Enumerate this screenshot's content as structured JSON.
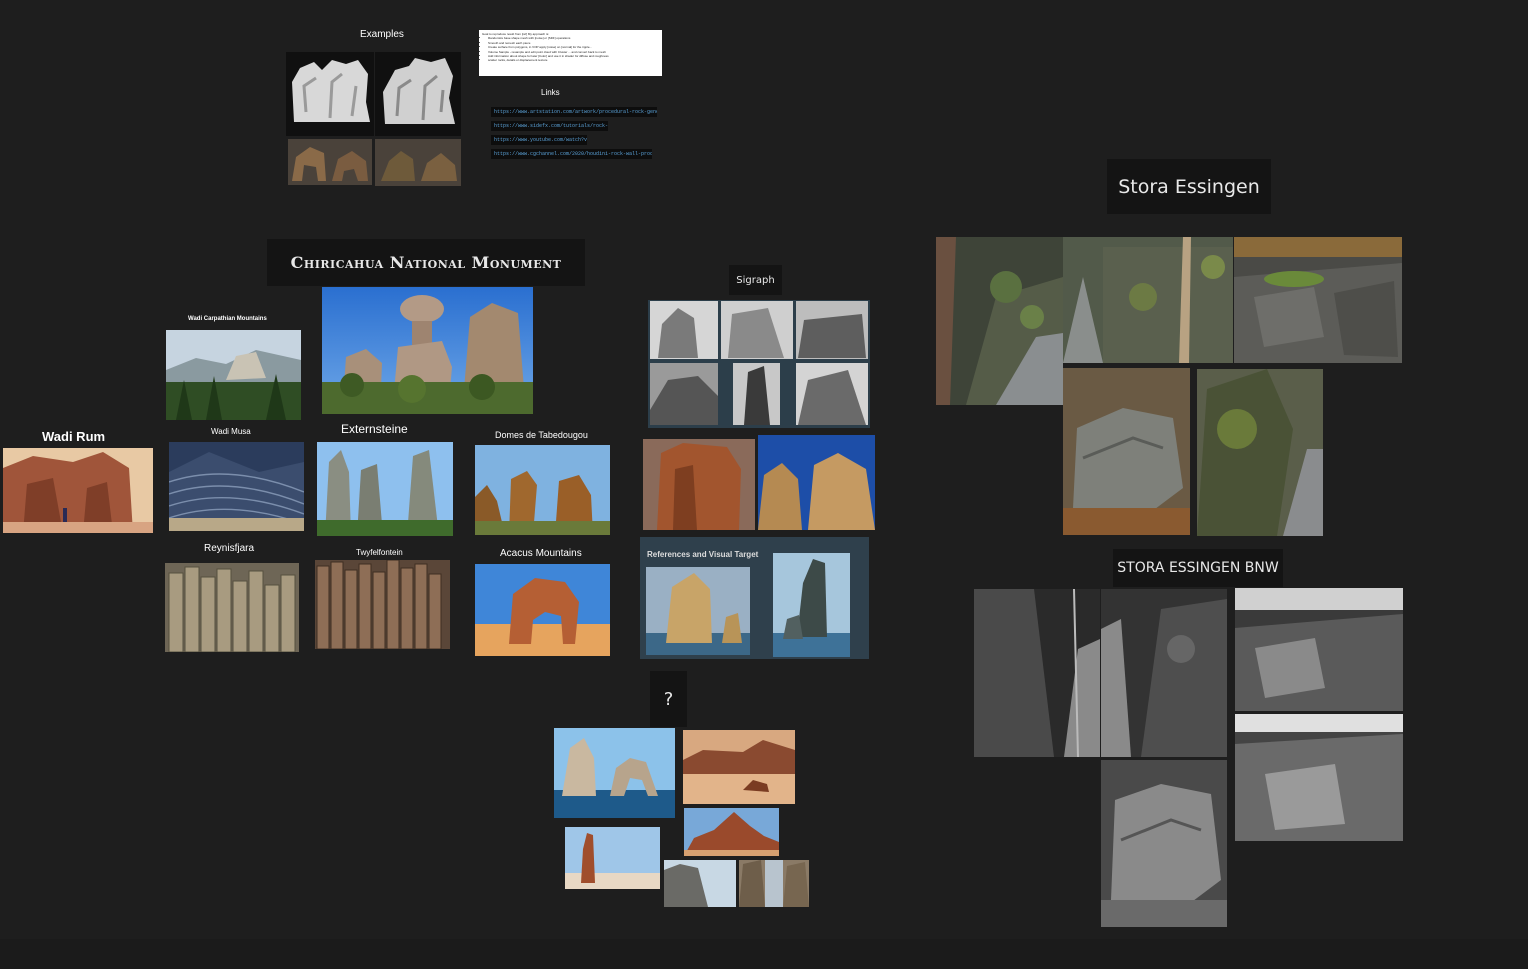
{
  "board": {
    "examples_title": "Examples",
    "links_title": "Links",
    "note_lines": [
      "Goal to reproduce result from [ref] My approach is:",
      "Randomize base shape mesh with [noise] or [SDF] operations",
      "Smooth and remesh each piece",
      "Create surface from polygons, in VOP apply [noise] on [normal] for the ripple...",
      "Volume Sample - resample and edit point cloud with Cluster ... and convert back to mesh",
      "Add information about shape for later [Color] and use it in shader for diffuse and roughness",
      "scatter rocks, details or displacement texture"
    ],
    "links": [
      "https://www.artstation.com/artwork/procedural-rock-generator-houdini",
      "https://www.sidefx.com/tutorials/rock-generator/",
      "https://www.youtube.com/watch?v=rock_tut",
      "https://www.cgchannel.com/2020/houdini-rock-wall-procedural"
    ],
    "headings": {
      "chiricahua": "Chiricahua National Monument",
      "sigraph": "Sigraph",
      "question": "?",
      "stora": "Stora Essingen",
      "stora_bnw": "STORA ESSINGEN BNW"
    },
    "captions": {
      "carpathian": "Wadi Carpathian Mountains",
      "wadi_rum": "Wadi Rum",
      "wadi_musa": "Wadi Musa",
      "externsteine": "Externsteine",
      "domes": "Domes de Tabedougou",
      "reynisfjara": "Reynisfjara",
      "twyfelfontein": "Twyfelfontein",
      "acacus": "Acacus Mountains",
      "ref_target": "References and Visual Target"
    }
  }
}
